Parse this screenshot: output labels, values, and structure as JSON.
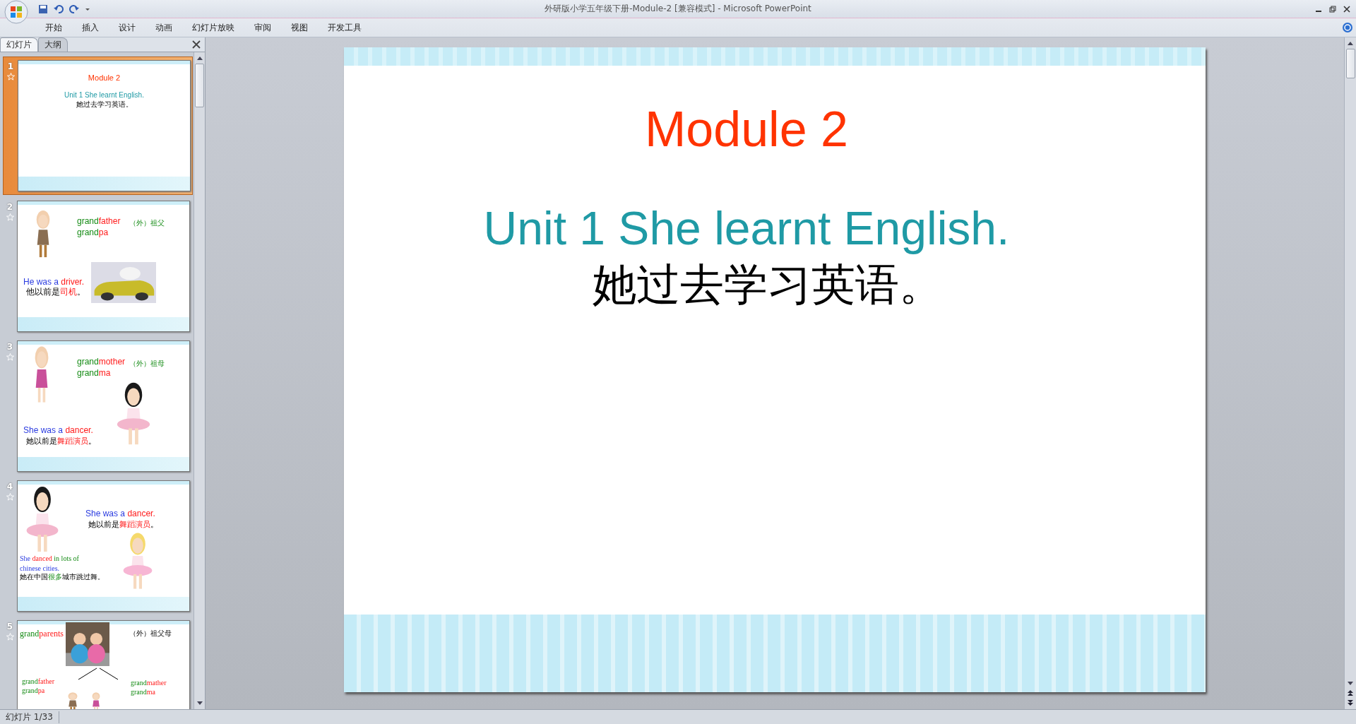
{
  "window": {
    "title": "外研版小学五年级下册-Module-2 [兼容模式] - Microsoft PowerPoint"
  },
  "ribbon_tabs": [
    "开始",
    "插入",
    "设计",
    "动画",
    "幻灯片放映",
    "审阅",
    "视图",
    "开发工具"
  ],
  "pane_tabs": [
    {
      "label": "幻灯片",
      "selected": true
    },
    {
      "label": "大纲",
      "selected": false
    }
  ],
  "slides": [
    {
      "number": "1",
      "selected": true,
      "texts": [
        {
          "segments": [
            {
              "text": "Module 2",
              "kind": "title"
            }
          ]
        },
        {
          "segments": [
            {
              "text": "Unit 1 She learnt  English.",
              "kind": "subtitle"
            }
          ]
        },
        {
          "segments": [
            {
              "text": "她过去学习英语。",
              "kind": "chinese"
            }
          ]
        }
      ]
    },
    {
      "number": "2",
      "selected": false,
      "texts": [
        {
          "segments": [
            {
              "text": "grand",
              "kind": "stem"
            },
            {
              "text": "father",
              "kind": "emphasis"
            }
          ]
        },
        {
          "segments": [
            {
              "text": "（外）祖父",
              "kind": "stem"
            }
          ]
        },
        {
          "segments": [
            {
              "text": "grand",
              "kind": "stem"
            },
            {
              "text": "pa",
              "kind": "emphasis"
            }
          ]
        },
        {
          "segments": [
            {
              "text": "He was a ",
              "kind": "english"
            },
            {
              "text": "driver.",
              "kind": "emphasis"
            }
          ]
        },
        {
          "segments": [
            {
              "text": "他以前是",
              "kind": "chinese"
            },
            {
              "text": "司机",
              "kind": "emphasis"
            },
            {
              "text": "。",
              "kind": "chinese"
            }
          ]
        }
      ]
    },
    {
      "number": "3",
      "selected": false,
      "texts": [
        {
          "segments": [
            {
              "text": "grand",
              "kind": "stem"
            },
            {
              "text": "mother",
              "kind": "emphasis"
            }
          ]
        },
        {
          "segments": [
            {
              "text": "（外）祖母",
              "kind": "stem"
            }
          ]
        },
        {
          "segments": [
            {
              "text": "grand",
              "kind": "stem"
            },
            {
              "text": "ma",
              "kind": "emphasis"
            }
          ]
        },
        {
          "segments": [
            {
              "text": "She was a ",
              "kind": "english"
            },
            {
              "text": "dancer.",
              "kind": "emphasis"
            }
          ]
        },
        {
          "segments": [
            {
              "text": "她以前是",
              "kind": "chinese"
            },
            {
              "text": "舞蹈演员",
              "kind": "emphasis"
            },
            {
              "text": "。",
              "kind": "chinese"
            }
          ]
        }
      ]
    },
    {
      "number": "4",
      "selected": false,
      "texts": [
        {
          "segments": [
            {
              "text": "She was a ",
              "kind": "english"
            },
            {
              "text": "dancer.",
              "kind": "emphasis"
            }
          ]
        },
        {
          "segments": [
            {
              "text": "她以前是",
              "kind": "chinese"
            },
            {
              "text": "舞蹈演员",
              "kind": "emphasis"
            },
            {
              "text": "。",
              "kind": "chinese"
            }
          ]
        },
        {
          "segments": [
            {
              "text": "She ",
              "kind": "english"
            },
            {
              "text": "danced ",
              "kind": "emphasis"
            },
            {
              "text": "in lots of",
              "kind": "stem"
            }
          ]
        },
        {
          "segments": [
            {
              "text": "chinese cities.",
              "kind": "english"
            }
          ]
        },
        {
          "segments": [
            {
              "text": "她在中国",
              "kind": "chinese"
            },
            {
              "text": "很多",
              "kind": "stem"
            },
            {
              "text": "城市跳过舞。",
              "kind": "chinese"
            }
          ]
        }
      ]
    },
    {
      "number": "5",
      "selected": false,
      "texts": [
        {
          "segments": [
            {
              "text": "grand",
              "kind": "stem"
            },
            {
              "text": "parents",
              "kind": "emphasis"
            }
          ]
        },
        {
          "segments": [
            {
              "text": "（外）祖父母",
              "kind": "chinese"
            }
          ]
        },
        {
          "segments": [
            {
              "text": "grand",
              "kind": "stem"
            },
            {
              "text": "father",
              "kind": "emphasis"
            }
          ]
        },
        {
          "segments": [
            {
              "text": "grand",
              "kind": "stem"
            },
            {
              "text": "pa",
              "kind": "emphasis"
            }
          ]
        },
        {
          "segments": [
            {
              "text": "grand",
              "kind": "stem"
            },
            {
              "text": "mather",
              "kind": "emphasis"
            }
          ]
        },
        {
          "segments": [
            {
              "text": "grand",
              "kind": "stem"
            },
            {
              "text": "ma",
              "kind": "emphasis"
            }
          ]
        }
      ]
    }
  ],
  "slide": {
    "title": "Module 2",
    "subtitle": "Unit 1 She learnt English.",
    "chinese": "她过去学习英语。"
  },
  "status_bar": {
    "slide_count": "幻灯片 1/33"
  }
}
